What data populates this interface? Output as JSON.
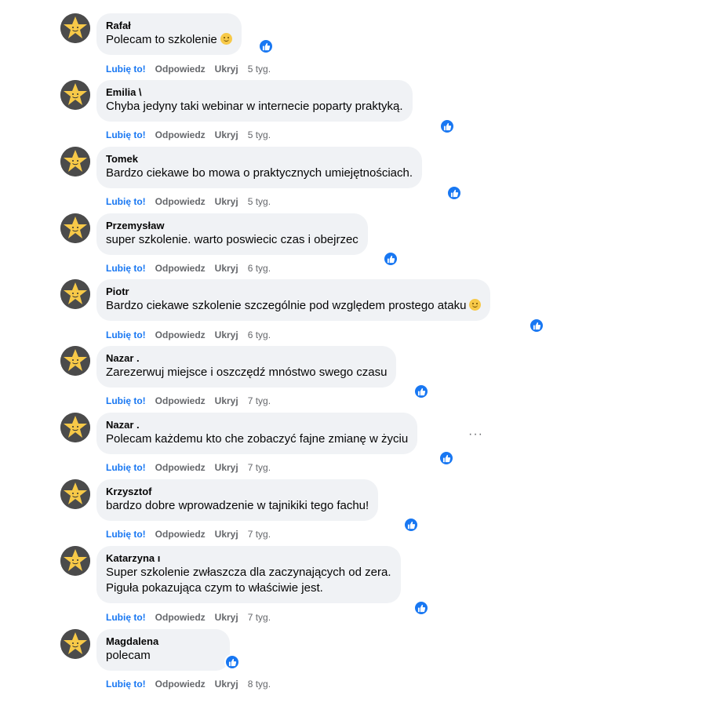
{
  "actions": {
    "like": "Lubię to!",
    "reply": "Odpowiedz",
    "hide": "Ukryj"
  },
  "colors": {
    "like_link": "#1877f2",
    "bubble": "#f0f2f5",
    "badge": "#1877f2"
  },
  "comments": [
    {
      "author": "Rafał",
      "lines": [
        "Polecam to szkolenie"
      ],
      "emoji": "slightly-smiling-face",
      "time": "5 tyg.",
      "reaction": "like-icon"
    },
    {
      "author": "Emilia \\",
      "lines": [
        "Chyba jedyny taki webinar w internecie poparty praktyką."
      ],
      "time": "5 tyg.",
      "reaction": "like-icon"
    },
    {
      "author": "Tomek",
      "lines": [
        "Bardzo ciekawe bo mowa o praktycznych umiejętnościach."
      ],
      "time": "5 tyg.",
      "reaction": "like-icon"
    },
    {
      "author": "Przemysław",
      "lines": [
        "super szkolenie. warto poswiecic czas i obejrzec"
      ],
      "time": "6 tyg.",
      "reaction": "like-icon"
    },
    {
      "author": "Piotr",
      "lines": [
        "Bardzo ciekawe szkolenie szczególnie pod względem prostego ataku"
      ],
      "emoji": "slightly-smiling-face",
      "time": "6 tyg.",
      "reaction": "like-icon"
    },
    {
      "author": "Nazar .",
      "lines": [
        "Zarezerwuj miejsce i oszczędź mnóstwo swego czasu"
      ],
      "time": "7 tyg.",
      "reaction": "like-icon"
    },
    {
      "author": "Nazar .",
      "lines": [
        "Polecam każdemu kto che zobaczyć fajne zmianę w życiu"
      ],
      "time": "7 tyg.",
      "reaction": "like-icon",
      "more": "···"
    },
    {
      "author": "Krzysztof",
      "lines": [
        "bardzo dobre wprowadzenie w tajnikiki tego fachu!"
      ],
      "time": "7 tyg.",
      "reaction": "like-icon"
    },
    {
      "author": "Katarzyna ı",
      "lines": [
        "Super szkolenie zwłaszcza dla zaczynających od zera.",
        "Piguła pokazująca czym to właściwie jest."
      ],
      "time": "7 tyg.",
      "reaction": "like-icon"
    },
    {
      "author": "Magdalena",
      "lines": [
        "polecam"
      ],
      "time": "8 tyg.",
      "reaction": "like-icon"
    }
  ]
}
